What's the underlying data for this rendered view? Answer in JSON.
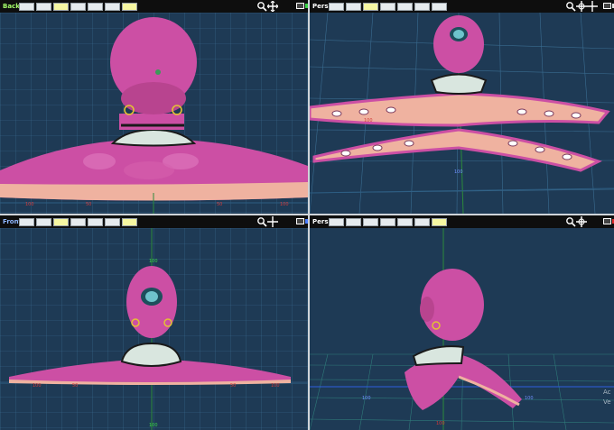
{
  "viewports": {
    "top_left": {
      "title": "Back"
    },
    "top_right": {
      "title": "Pers"
    },
    "bottom_left": {
      "title": "Front"
    },
    "bottom_right": {
      "title": "Pers"
    }
  },
  "axis_labels": {
    "tl_a": "100",
    "tl_b": "50",
    "tl_c": "50",
    "tl_d": "100",
    "tr_a": "100",
    "tr_b": "100",
    "bl_a": "100",
    "bl_b": "50",
    "bl_c": "50",
    "bl_d": "100",
    "bl_top": "100",
    "bl_bottom": "100",
    "br_a": "100",
    "br_b": "100",
    "br_c": "100"
  },
  "watermark": {
    "line1": "Ac",
    "line2": "Ve"
  },
  "colors": {
    "bg": "#1e3a55",
    "grid": "#3a6c90",
    "skin": "#cc4fa4",
    "belly": "#efb2a0",
    "collar": "#d9e6df"
  }
}
